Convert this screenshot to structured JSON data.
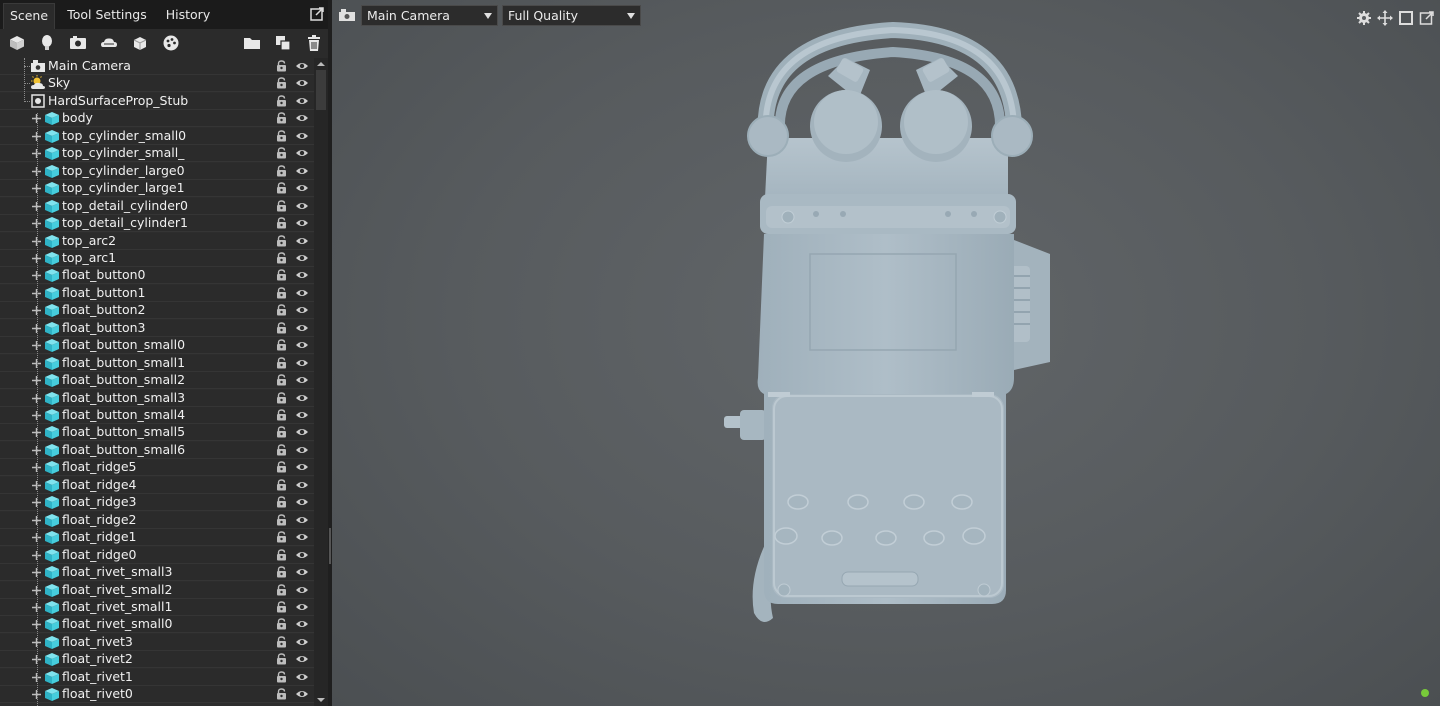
{
  "tabs": {
    "scene": "Scene",
    "tool_settings": "Tool Settings",
    "history": "History"
  },
  "scene_toolbar_icons": [
    "cube-icon",
    "light-icon",
    "camera-icon",
    "cloud-icon",
    "primitive-icon",
    "palette-icon",
    "folder-icon",
    "duplicate-icon",
    "trash-icon"
  ],
  "tree": {
    "roots": [
      "Main Camera",
      "Sky",
      "HardSurfaceProp_Stub"
    ],
    "children": [
      "body",
      "top_cylinder_small0",
      "top_cylinder_small_",
      "top_cylinder_large0",
      "top_cylinder_large1",
      "top_detail_cylinder0",
      "top_detail_cylinder1",
      "top_arc2",
      "top_arc1",
      "float_button0",
      "float_button1",
      "float_button2",
      "float_button3",
      "float_button_small0",
      "float_button_small1",
      "float_button_small2",
      "float_button_small3",
      "float_button_small4",
      "float_button_small5",
      "float_button_small6",
      "float_ridge5",
      "float_ridge4",
      "float_ridge3",
      "float_ridge2",
      "float_ridge1",
      "float_ridge0",
      "float_rivet_small3",
      "float_rivet_small2",
      "float_rivet_small1",
      "float_rivet_small0",
      "float_rivet3",
      "float_rivet2",
      "float_rivet1",
      "float_rivet0"
    ]
  },
  "viewport": {
    "camera_select": "Main Camera",
    "quality_select": "Full Quality",
    "icons": [
      "gear-icon",
      "move-icon",
      "maximize-icon",
      "popout-icon"
    ],
    "status_color": "#78c93a"
  },
  "colors": {
    "panel": "#2b2b2b",
    "tab_bar": "#1b1b1b",
    "cube_cyan": "#3fc9d9",
    "model": "#a9b9c3"
  }
}
